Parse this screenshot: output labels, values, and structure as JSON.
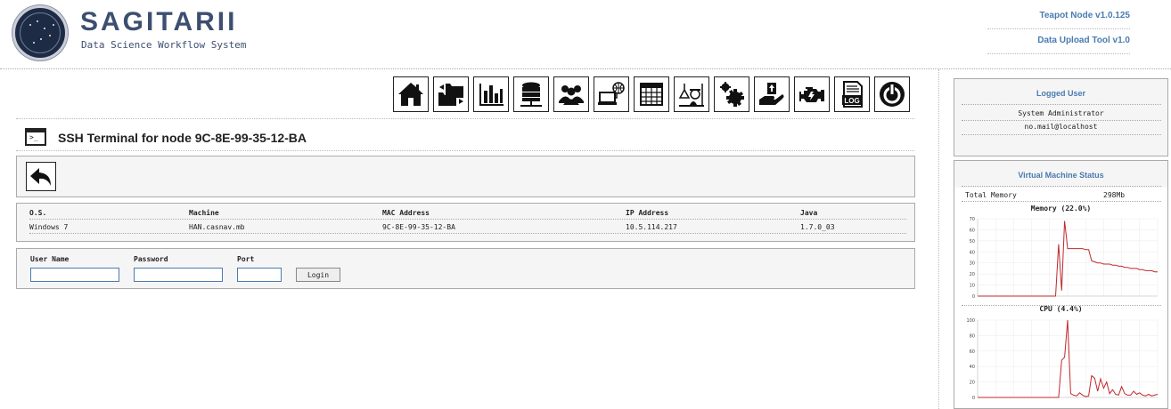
{
  "app": {
    "title": "SAGITARII",
    "subtitle": "Data Science Workflow System",
    "node_link": "Teapot Node v1.0.125",
    "upload_link": "Data Upload Tool v1.0"
  },
  "toolbar": {
    "icons": [
      "home-icon",
      "folder-transfer-icon",
      "bar-chart-icon",
      "database-icon",
      "users-icon",
      "network-computer-icon",
      "table-icon",
      "lab-flask-icon",
      "gears-icon",
      "hand-upload-icon",
      "engine-icon",
      "log-icon",
      "power-icon"
    ],
    "log_label": "LOG"
  },
  "page": {
    "title": "SSH Terminal for node 9C-8E-99-35-12-BA",
    "terminal_prompt": ">_"
  },
  "node_info": {
    "headers": [
      "O.S.",
      "Machine",
      "MAC Address",
      "IP Address",
      "Java"
    ],
    "values": [
      "Windows 7",
      "HAN.casnav.mb",
      "9C-8E-99-35-12-BA",
      "10.5.114.217",
      "1.7.0_03"
    ]
  },
  "login_form": {
    "user_label": "User Name",
    "password_label": "Password",
    "port_label": "Port",
    "user_value": "",
    "password_value": "",
    "port_value": "",
    "login_label": "Login"
  },
  "logged_user": {
    "title": "Logged User",
    "name": "System Administrator",
    "email": "no.mail@localhost"
  },
  "vm_status": {
    "title": "Virtual Machine Status",
    "memory_label": "Total Memory",
    "memory_value": "298Mb"
  },
  "chart_data": [
    {
      "type": "line",
      "title": "Memory (22.0%)",
      "ylim": [
        0,
        70
      ],
      "yticks": [
        "0",
        "10",
        "20",
        "30",
        "40",
        "50",
        "60",
        "70"
      ],
      "line_color": "#c0282d",
      "grid": true,
      "x": [
        0,
        1,
        2,
        3,
        4,
        5,
        6,
        7,
        8,
        9,
        10,
        11,
        12,
        13,
        14,
        15,
        16,
        17,
        18,
        19,
        20,
        21,
        22,
        23,
        24,
        25,
        26,
        27,
        28,
        29,
        30,
        31,
        32,
        33,
        34,
        35,
        36,
        37,
        38,
        39,
        40,
        41,
        42,
        43,
        44,
        45,
        46,
        47,
        48,
        49,
        50,
        51,
        52,
        53,
        54,
        55,
        56,
        57,
        58,
        59,
        60
      ],
      "values": [
        0,
        0,
        0,
        0,
        0,
        0,
        0,
        0,
        0,
        0,
        0,
        0,
        0,
        0,
        0,
        0,
        0,
        0,
        0,
        0,
        0,
        0,
        0,
        0,
        0,
        0,
        0,
        47,
        5,
        68,
        43,
        43,
        43,
        43,
        43,
        43,
        42,
        42,
        32,
        31,
        30,
        30,
        29,
        29,
        29,
        28,
        28,
        27,
        27,
        26,
        26,
        25,
        25,
        25,
        24,
        24,
        23,
        23,
        23,
        22,
        22
      ]
    },
    {
      "type": "line",
      "title": "CPU (4.4%)",
      "ylim": [
        0,
        100
      ],
      "yticks": [
        "0",
        "20",
        "40",
        "60",
        "80",
        "100"
      ],
      "line_color": "#c0282d",
      "grid": true,
      "x": [
        0,
        1,
        2,
        3,
        4,
        5,
        6,
        7,
        8,
        9,
        10,
        11,
        12,
        13,
        14,
        15,
        16,
        17,
        18,
        19,
        20,
        21,
        22,
        23,
        24,
        25,
        26,
        27,
        28,
        29,
        30,
        31,
        32,
        33,
        34,
        35,
        36,
        37,
        38,
        39,
        40,
        41,
        42,
        43,
        44,
        45,
        46,
        47,
        48,
        49,
        50,
        51,
        52,
        53,
        54,
        55,
        56,
        57,
        58,
        59,
        60
      ],
      "values": [
        0,
        0,
        0,
        0,
        0,
        0,
        0,
        0,
        0,
        0,
        0,
        0,
        0,
        0,
        0,
        0,
        0,
        0,
        0,
        0,
        0,
        0,
        0,
        0,
        0,
        0,
        0,
        0,
        48,
        52,
        100,
        5,
        3,
        2,
        6,
        3,
        1,
        2,
        28,
        25,
        8,
        24,
        12,
        20,
        5,
        10,
        4,
        3,
        14,
        5,
        3,
        3,
        8,
        4,
        6,
        3,
        2,
        4,
        2,
        3,
        4
      ]
    }
  ]
}
